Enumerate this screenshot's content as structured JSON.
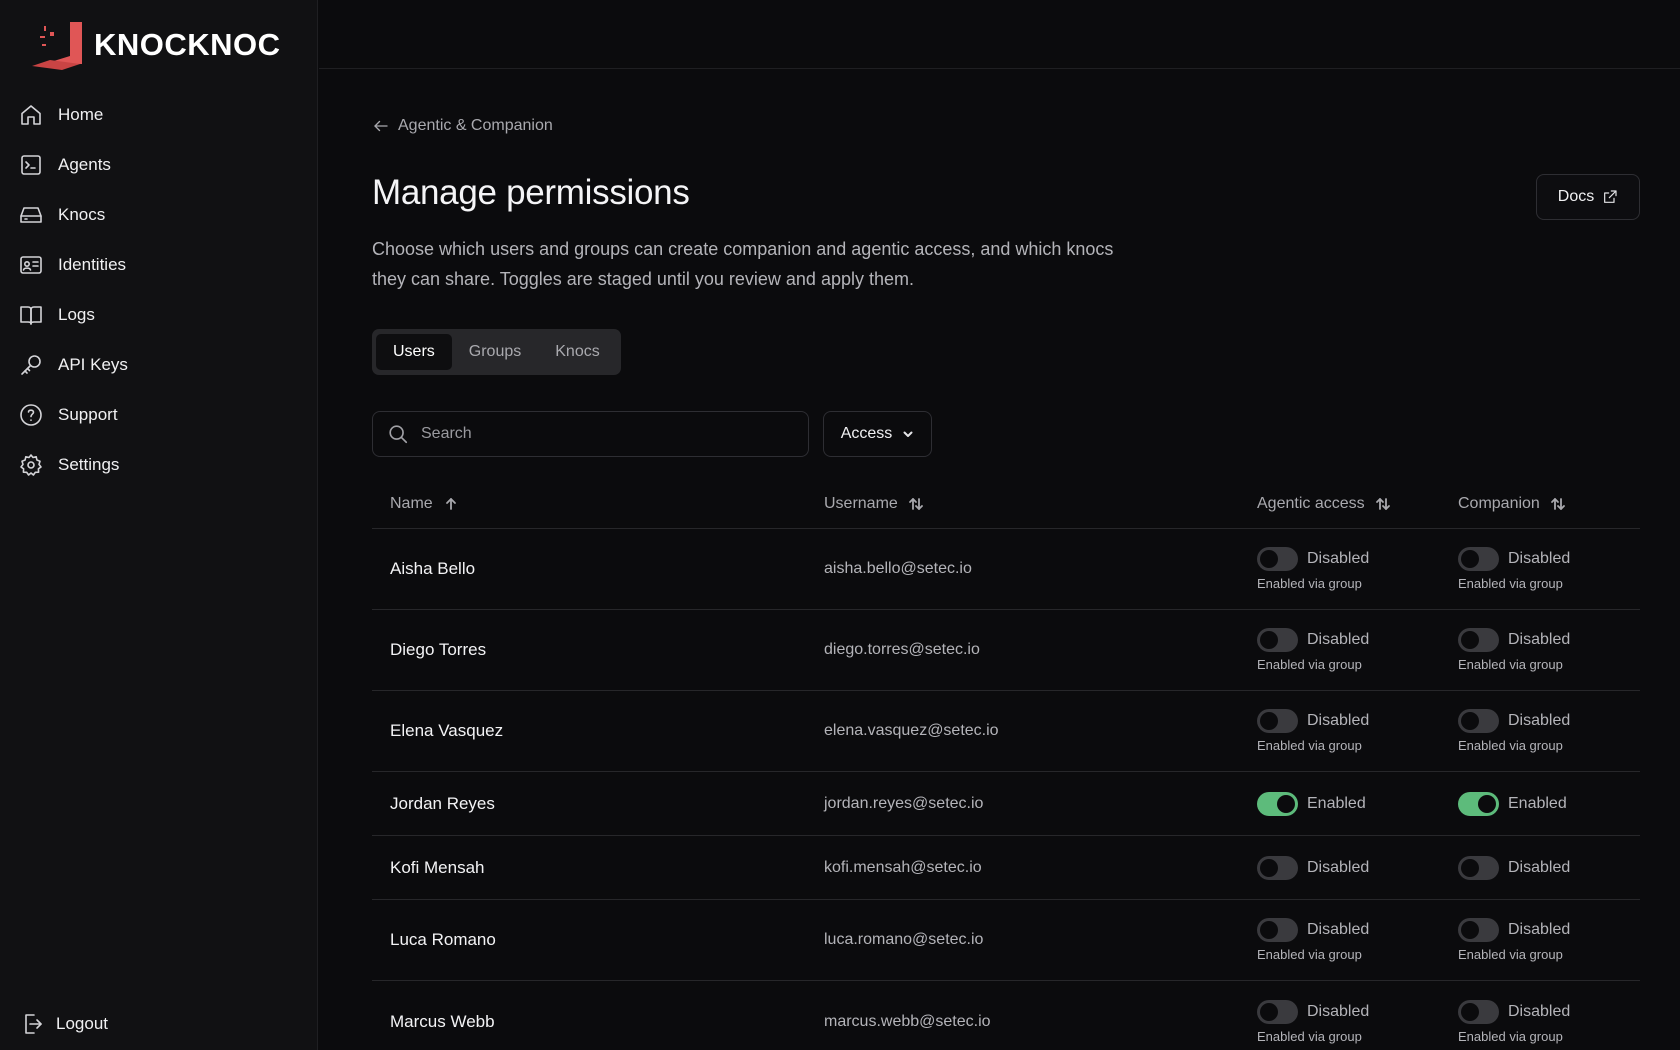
{
  "brand": {
    "name": "KNOCKNOC",
    "accent": "#e05656"
  },
  "sidebar": {
    "items": [
      {
        "label": "Home",
        "icon": "home-icon"
      },
      {
        "label": "Agents",
        "icon": "terminal-icon"
      },
      {
        "label": "Knocs",
        "icon": "drive-icon"
      },
      {
        "label": "Identities",
        "icon": "id-card-icon"
      },
      {
        "label": "Logs",
        "icon": "book-icon"
      },
      {
        "label": "API Keys",
        "icon": "key-icon"
      },
      {
        "label": "Support",
        "icon": "help-circle-icon"
      },
      {
        "label": "Settings",
        "icon": "gear-icon"
      }
    ],
    "logout": "Logout"
  },
  "breadcrumb": {
    "label": "Agentic & Companion"
  },
  "page": {
    "title": "Manage permissions",
    "description": "Choose which users and groups can create companion and agentic access, and which knocs they can share. Toggles are staged until you review and apply them.",
    "docs_label": "Docs"
  },
  "tabs": [
    {
      "label": "Users",
      "active": true
    },
    {
      "label": "Groups",
      "active": false
    },
    {
      "label": "Knocs",
      "active": false
    }
  ],
  "search": {
    "placeholder": "Search",
    "value": ""
  },
  "filter": {
    "label": "Access"
  },
  "table": {
    "columns": {
      "name": "Name",
      "username": "Username",
      "agentic": "Agentic access",
      "companion": "Companion"
    },
    "rows": [
      {
        "name": "Aisha Bello",
        "username": "aisha.bello@setec.io",
        "agentic": {
          "on": false,
          "state": "Disabled",
          "sub": "Enabled via group"
        },
        "companion": {
          "on": false,
          "state": "Disabled",
          "sub": "Enabled via group"
        }
      },
      {
        "name": "Diego Torres",
        "username": "diego.torres@setec.io",
        "agentic": {
          "on": false,
          "state": "Disabled",
          "sub": "Enabled via group"
        },
        "companion": {
          "on": false,
          "state": "Disabled",
          "sub": "Enabled via group"
        }
      },
      {
        "name": "Elena Vasquez",
        "username": "elena.vasquez@setec.io",
        "agentic": {
          "on": false,
          "state": "Disabled",
          "sub": "Enabled via group"
        },
        "companion": {
          "on": false,
          "state": "Disabled",
          "sub": "Enabled via group"
        }
      },
      {
        "name": "Jordan Reyes",
        "username": "jordan.reyes@setec.io",
        "agentic": {
          "on": true,
          "state": "Enabled",
          "sub": ""
        },
        "companion": {
          "on": true,
          "state": "Enabled",
          "sub": ""
        }
      },
      {
        "name": "Kofi Mensah",
        "username": "kofi.mensah@setec.io",
        "agentic": {
          "on": false,
          "state": "Disabled",
          "sub": ""
        },
        "companion": {
          "on": false,
          "state": "Disabled",
          "sub": ""
        }
      },
      {
        "name": "Luca Romano",
        "username": "luca.romano@setec.io",
        "agentic": {
          "on": false,
          "state": "Disabled",
          "sub": "Enabled via group"
        },
        "companion": {
          "on": false,
          "state": "Disabled",
          "sub": "Enabled via group"
        }
      },
      {
        "name": "Marcus Webb",
        "username": "marcus.webb@setec.io",
        "agentic": {
          "on": false,
          "state": "Disabled",
          "sub": "Enabled via group"
        },
        "companion": {
          "on": false,
          "state": "Disabled",
          "sub": "Enabled via group"
        }
      }
    ]
  },
  "colors": {
    "toggle_on": "#5dbb7b",
    "toggle_off": "#3a3a3e"
  }
}
